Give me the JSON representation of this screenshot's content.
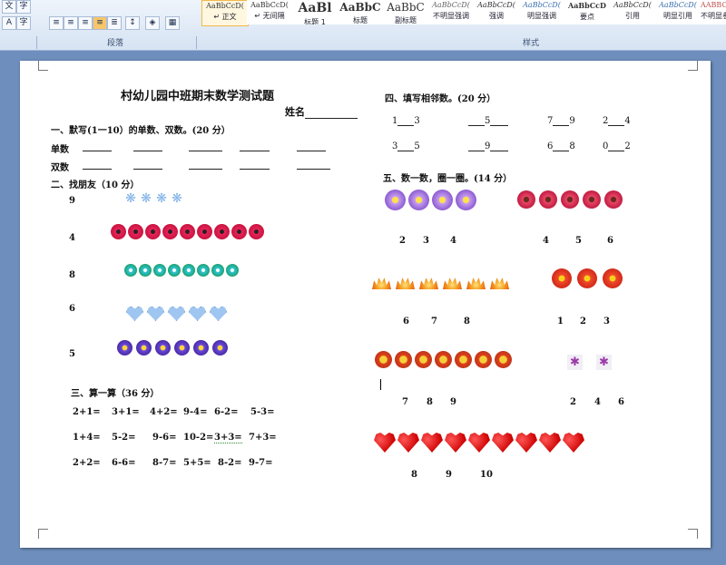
{
  "ribbon": {
    "paragraph_group_label": "段落",
    "styles_group_label": "样式",
    "left_buttons": [
      "文",
      "字",
      "A",
      "字"
    ],
    "styles": [
      {
        "sample": "AaBbCcD(",
        "name": "↵ 正文"
      },
      {
        "sample": "AaBbCcD(",
        "name": "↵ 无间隔"
      },
      {
        "sample": "AaBl",
        "name": "标题 1"
      },
      {
        "sample": "AaBbC",
        "name": "标题"
      },
      {
        "sample": "AaBbC",
        "name": "副标题"
      },
      {
        "sample": "AaBbCcD(",
        "name": "不明显强调"
      },
      {
        "sample": "AaBbCcD(",
        "name": "强调"
      },
      {
        "sample": "AaBbCcD(",
        "name": "明显强调"
      },
      {
        "sample": "AaBbCcD",
        "name": "要点"
      },
      {
        "sample": "AaBbCcD(",
        "name": "引用"
      },
      {
        "sample": "AaBbCcD(",
        "name": "明显引用"
      },
      {
        "sample": "AABBCCD",
        "name": "不明显参"
      }
    ]
  },
  "doc": {
    "title": "村幼儿园中班期末数学测试题",
    "name_label": "姓名",
    "s1_heading": "一、默写(1一10）的单数、双数。(20 分）",
    "s1_odd_label": "单数",
    "s1_even_label": "双数",
    "s2_heading": "二、找朋友（10 分）",
    "s2_numbers": [
      "9",
      "4",
      "8",
      "6",
      "5"
    ],
    "s3_heading": "三、算一算（36 分）",
    "s3_rows": [
      [
        "2+1=",
        "3+1=",
        "4+2=",
        "9-4=",
        "6-2=",
        "5-3="
      ],
      [
        "1+4=",
        "5-2=",
        "9-6=",
        "10-2=",
        "3+3=",
        "7+3="
      ],
      [
        "2+2=",
        "6-6=",
        "8-7=",
        "5+5=",
        "8-2=",
        "9-7="
      ]
    ],
    "s4_heading": "四、填写相邻数。(20 分）",
    "s4_row1": [
      "1",
      "3",
      "5",
      "7",
      "9",
      "2",
      "4"
    ],
    "s4_row2": [
      "3",
      "5",
      "9",
      "6",
      "8",
      "0",
      "2"
    ],
    "s5_heading": "五、数一数，圈一圈。(14 分）",
    "s5_groups": [
      [
        "2",
        "3",
        "4"
      ],
      [
        "4",
        "5",
        "6"
      ],
      [
        "6",
        "7",
        "8"
      ],
      [
        "1",
        "2",
        "3"
      ],
      [
        "7",
        "8",
        "9"
      ],
      [
        "2",
        "4",
        "6"
      ],
      [
        "8",
        "9",
        "10"
      ]
    ]
  },
  "colors": {
    "ribbon_bg": "#dce7f5",
    "page_bg": "#ffffff",
    "workspace_bg": "#6e8fbd"
  }
}
